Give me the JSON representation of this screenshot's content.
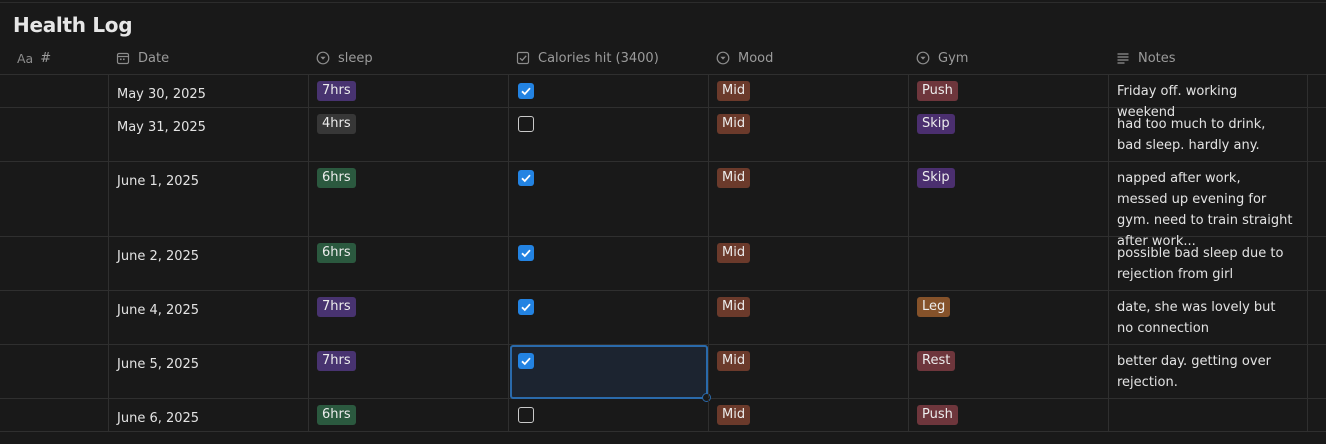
{
  "page": {
    "title": "Health Log"
  },
  "columns": {
    "aa": "Aa",
    "hash": "#",
    "date": "Date",
    "sleep": "sleep",
    "calories": "Calories hit (3400)",
    "mood": "Mood",
    "gym": "Gym",
    "notes": "Notes"
  },
  "tag_colors": {
    "purple": "#483370",
    "gray": "#373737",
    "green": "#2b593f",
    "brown": "#6b3a2b",
    "violet": "#4b2f6f",
    "red": "#6e363c",
    "orange": "#85522a",
    "checkbox": "#2383e2"
  },
  "rows": [
    {
      "date": "May 30, 2025",
      "sleep": "7hrs",
      "calories_hit": true,
      "mood": "Mid",
      "gym": "Push",
      "notes": "Friday off. working weekend"
    },
    {
      "date": "May 31, 2025",
      "sleep": "4hrs",
      "calories_hit": false,
      "mood": "Mid",
      "gym": "Skip",
      "notes": "had too much to drink, bad sleep. hardly any."
    },
    {
      "date": "June 1, 2025",
      "sleep": "6hrs",
      "calories_hit": true,
      "mood": "Mid",
      "gym": "Skip",
      "notes": "napped after work, messed up evening for gym. need to train straight after work..."
    },
    {
      "date": "June 2, 2025",
      "sleep": "6hrs",
      "calories_hit": true,
      "mood": "Mid",
      "gym": "",
      "notes": "possible bad sleep due to rejection from girl"
    },
    {
      "date": "June 4, 2025",
      "sleep": "7hrs",
      "calories_hit": true,
      "mood": "Mid",
      "gym": "Leg",
      "notes": "date, she was lovely but no connection"
    },
    {
      "date": "June 5, 2025",
      "sleep": "7hrs",
      "calories_hit": true,
      "mood": "Mid",
      "gym": "Rest",
      "notes": "better day. getting over rejection."
    },
    {
      "date": "June 6, 2025",
      "sleep": "6hrs",
      "calories_hit": false,
      "mood": "Mid",
      "gym": "Push",
      "notes": ""
    }
  ]
}
